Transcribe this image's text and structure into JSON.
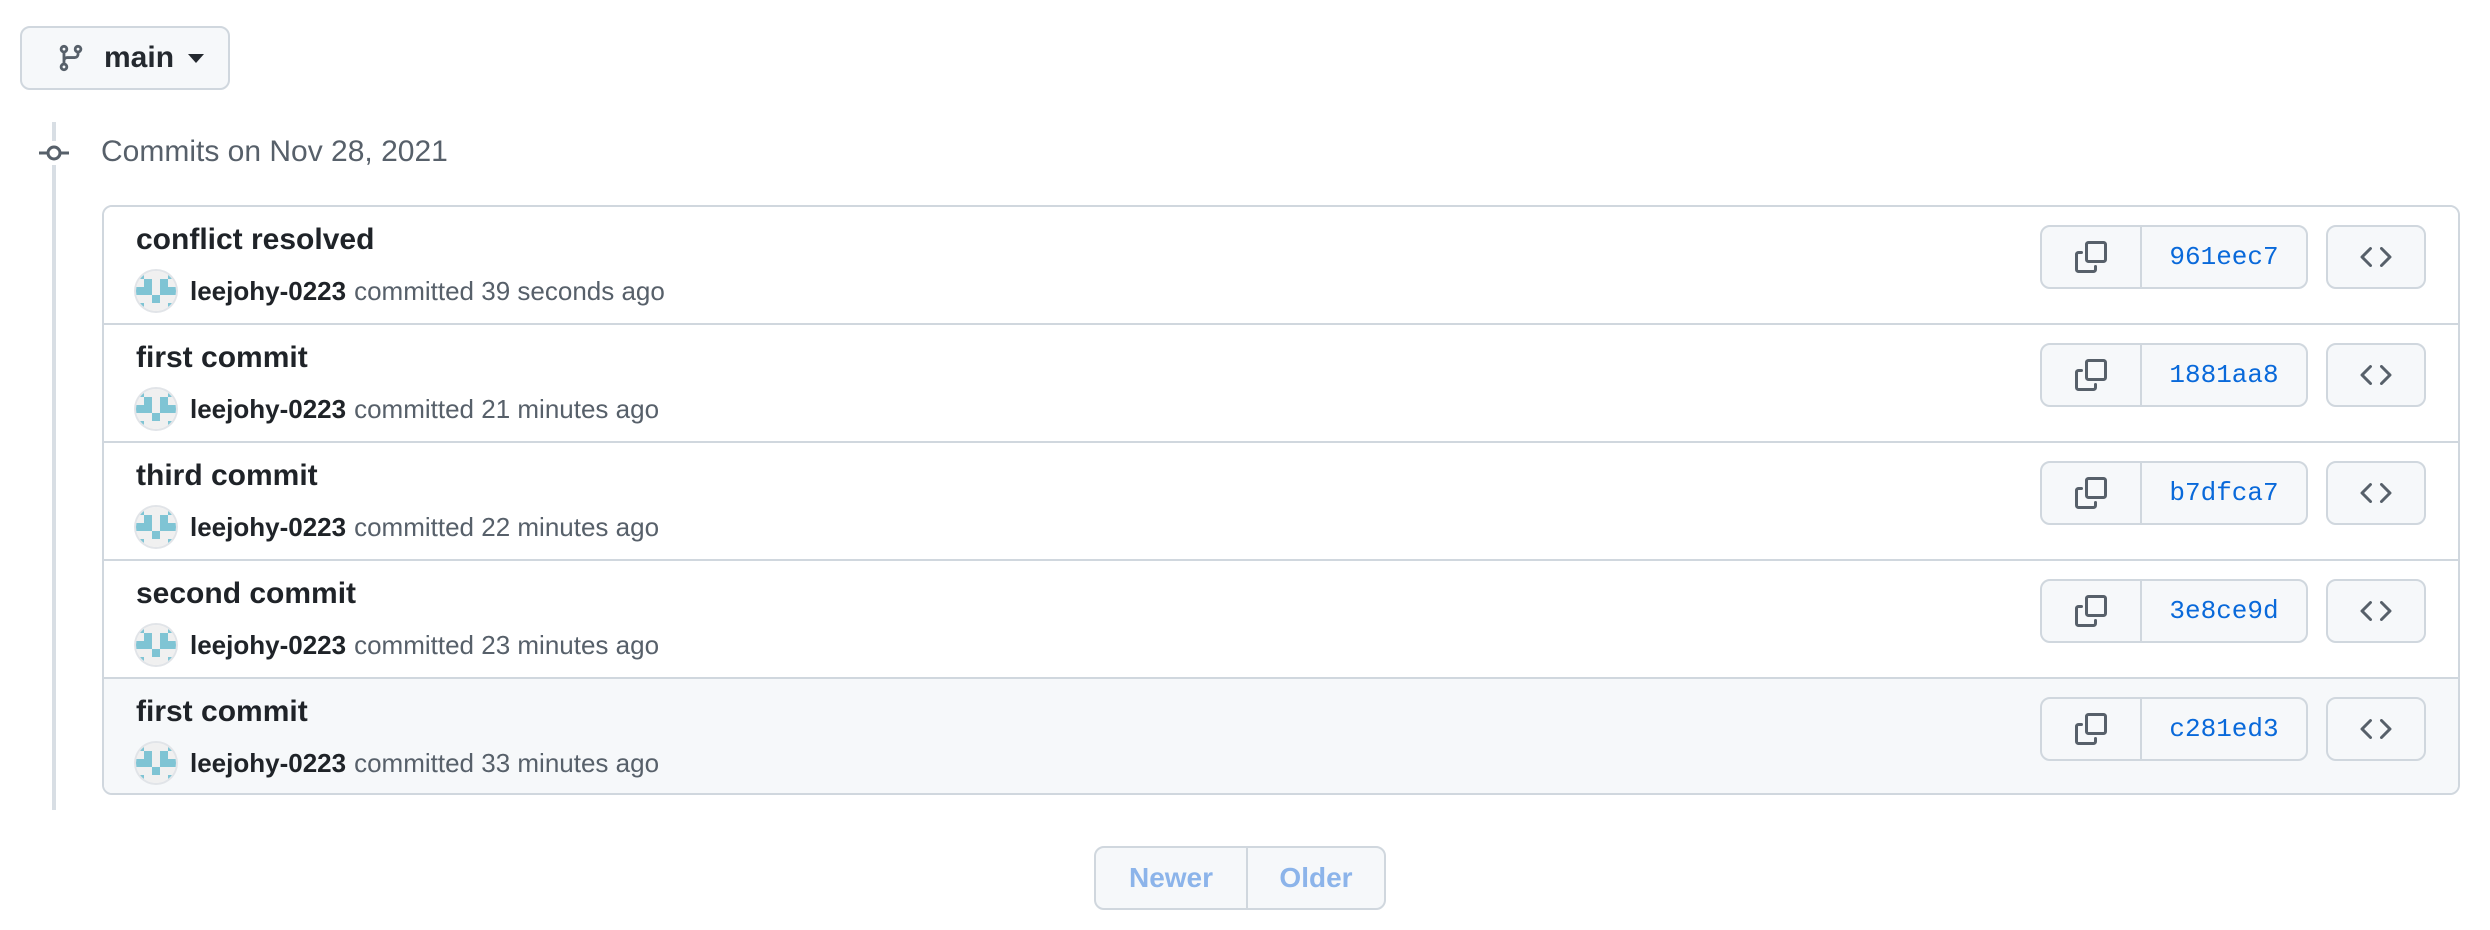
{
  "branch": {
    "name": "main",
    "icon": "git-branch-icon"
  },
  "group": {
    "title": "Commits on Nov 28, 2021",
    "icon": "git-commit-icon"
  },
  "commits": [
    {
      "title": "conflict resolved",
      "author": "leejohy-0223",
      "action": "committed",
      "time": "39 seconds ago",
      "sha": "961eec7"
    },
    {
      "title": "first commit",
      "author": "leejohy-0223",
      "action": "committed",
      "time": "21 minutes ago",
      "sha": "1881aa8"
    },
    {
      "title": "third commit",
      "author": "leejohy-0223",
      "action": "committed",
      "time": "22 minutes ago",
      "sha": "b7dfca7"
    },
    {
      "title": "second commit",
      "author": "leejohy-0223",
      "action": "committed",
      "time": "23 minutes ago",
      "sha": "3e8ce9d"
    },
    {
      "title": "first commit",
      "author": "leejohy-0223",
      "action": "committed",
      "time": "33 minutes ago",
      "sha": "c281ed3"
    }
  ],
  "pagination": {
    "newer": "Newer",
    "older": "Older"
  },
  "colors": {
    "link": "#0969da",
    "border": "#d0d7de",
    "disabled": "#8cb4ea",
    "avatar_primary": "#7fc4d4"
  }
}
